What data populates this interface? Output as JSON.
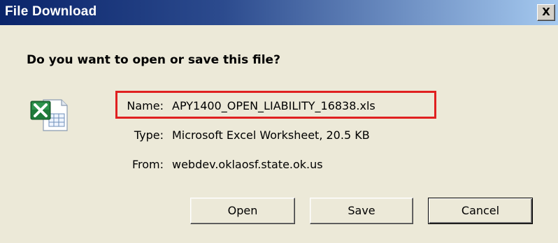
{
  "window": {
    "title": "File Download",
    "close_label": "X"
  },
  "prompt": {
    "question": "Do you want to open or save this file?"
  },
  "file": {
    "icon": "excel-file-icon",
    "name_label": "Name:",
    "name_value": "APY1400_OPEN_LIABILITY_16838.xls",
    "type_label": "Type:",
    "type_value": "Microsoft Excel Worksheet, 20.5 KB",
    "from_label": "From:",
    "from_value": "webdev.oklaosf.state.ok.us"
  },
  "buttons": {
    "open_label": "Open",
    "save_label": "Save",
    "cancel_label": "Cancel"
  },
  "colors": {
    "titlebar_start": "#0a246a",
    "titlebar_end": "#a6caf0",
    "dialog_bg": "#ece9d8",
    "highlight": "#e02020",
    "excel_green": "#1f7a3a"
  }
}
